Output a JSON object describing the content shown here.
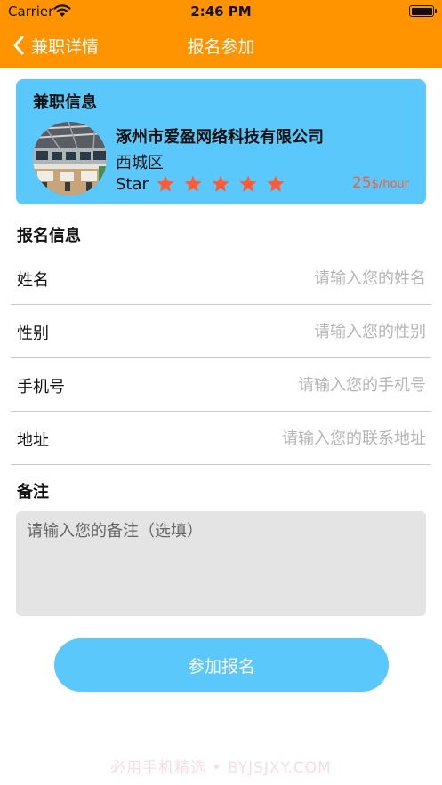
{
  "status_bar": {
    "carrier": "Carrier",
    "time": "2:46 PM"
  },
  "nav": {
    "back_label": "兼职详情",
    "title": "报名参加"
  },
  "job_card": {
    "title": "兼职信息",
    "company": "涿州市爱盈网络科技有限公司",
    "district": "西城区",
    "star_label": "Star",
    "rating": 5,
    "rating_max": 5,
    "wage_value": "25",
    "wage_unit": "$/hour"
  },
  "signup": {
    "title": "报名信息",
    "fields": [
      {
        "label": "姓名",
        "placeholder": "请输入您的姓名",
        "value": ""
      },
      {
        "label": "性别",
        "placeholder": "请输入您的性别",
        "value": ""
      },
      {
        "label": "手机号",
        "placeholder": "请输入您的手机号",
        "value": ""
      },
      {
        "label": "地址",
        "placeholder": "请输入您的联系地址",
        "value": ""
      }
    ]
  },
  "remarks": {
    "title": "备注",
    "placeholder": "请输入您的备注（选填）",
    "value": ""
  },
  "submit": {
    "label": "参加报名"
  },
  "watermark": "必用手机精选 • BYJSJXY.COM",
  "colors": {
    "header": "#FF9400",
    "card": "#5AC8FA",
    "button": "#5AC8FA",
    "star": "#FF5A36",
    "wage": "#FF5A36",
    "remark_bg": "#E4E4E4"
  }
}
